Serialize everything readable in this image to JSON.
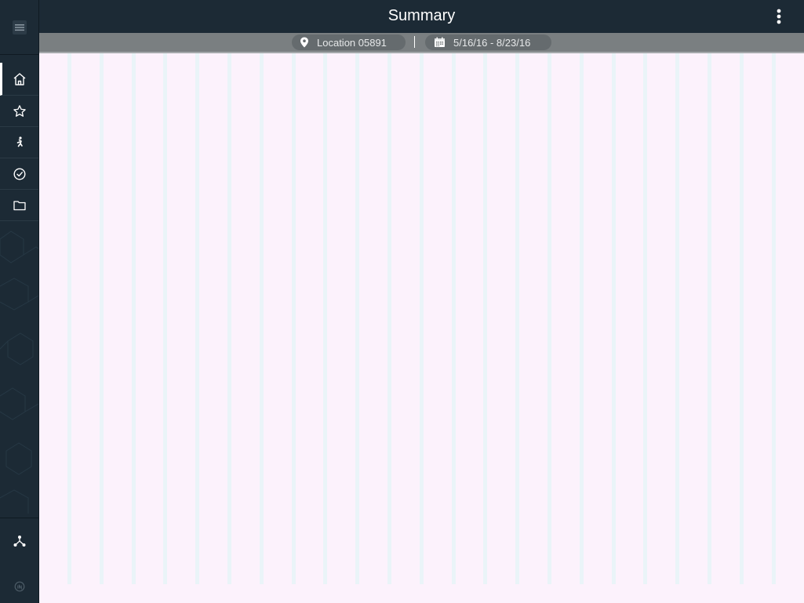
{
  "header": {
    "title": "Summary"
  },
  "filters": {
    "location": "Location 05891",
    "date_range": "5/16/16 - 8/23/16"
  },
  "sidebar": {
    "items": [
      {
        "name": "home",
        "icon": "home-icon",
        "active": true
      },
      {
        "name": "favorites",
        "icon": "star-icon",
        "active": false
      },
      {
        "name": "activity",
        "icon": "running-person-icon",
        "active": false
      },
      {
        "name": "tasks",
        "icon": "check-circle-icon",
        "active": false
      },
      {
        "name": "files",
        "icon": "folder-icon",
        "active": false
      }
    ]
  },
  "colors": {
    "sidebar_bg": "#1c2a35",
    "filter_bar_bg": "#7a7f81",
    "content_bg": "#fcf2fc",
    "stripe": "#eaf4f8"
  }
}
